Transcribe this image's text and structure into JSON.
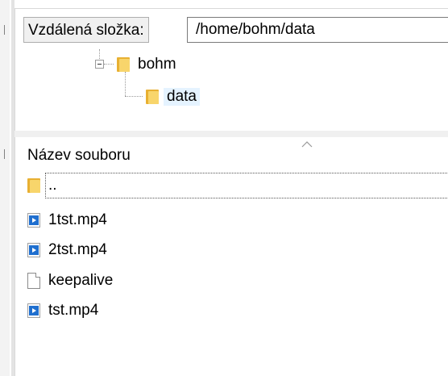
{
  "remote": {
    "path_label": "Vzdálená složka:",
    "path_value": "/home/bohm/data"
  },
  "tree": {
    "items": [
      {
        "label": "bohm",
        "icon": "folder-icon",
        "expanded": true
      },
      {
        "label": "data",
        "icon": "folder-icon",
        "selected": true
      }
    ]
  },
  "file_list": {
    "column_header": "Název souboru",
    "sort_indicator": "chevron-up-icon",
    "rows": [
      {
        "name": "..",
        "icon": "folder-icon"
      },
      {
        "name": "1tst.mp4",
        "icon": "video-file-icon"
      },
      {
        "name": "2tst.mp4",
        "icon": "video-file-icon"
      },
      {
        "name": "keepalive",
        "icon": "file-icon"
      },
      {
        "name": "tst.mp4",
        "icon": "video-file-icon"
      }
    ]
  },
  "colors": {
    "folder_back": "#e8b032",
    "folder_front": "#f8d56b",
    "video_blue": "#1f6fcf",
    "selection": "#e5f3ff"
  }
}
